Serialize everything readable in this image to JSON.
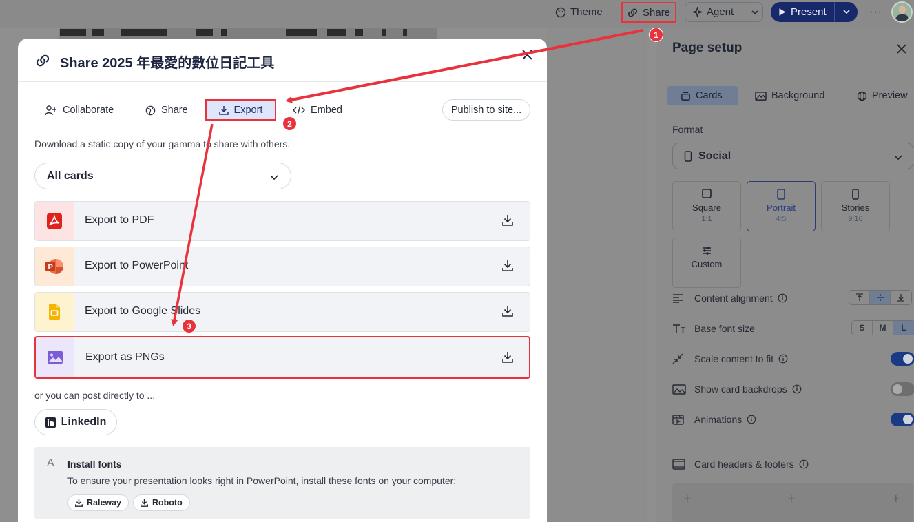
{
  "topbar": {
    "theme_label": "Theme",
    "share_label": "Share",
    "agent_label": "Agent",
    "present_label": "Present",
    "more_label": "···"
  },
  "modal": {
    "title": "Share 2025 年最愛的數位日記工具",
    "tabs": [
      {
        "label": "Collaborate",
        "icon": "user-plus-icon"
      },
      {
        "label": "Share",
        "icon": "globe-icon"
      },
      {
        "label": "Export",
        "icon": "download-icon",
        "active": true
      },
      {
        "label": "Embed",
        "icon": "code-icon"
      }
    ],
    "publish_label": "Publish to site...",
    "description": "Download a static copy of your gamma to share with others.",
    "scope_select": "All cards",
    "export_options": [
      {
        "label": "Export to PDF",
        "icon": "pdf-icon",
        "color": "#fde3e3"
      },
      {
        "label": "Export to PowerPoint",
        "icon": "powerpoint-icon",
        "color": "#fde9d6"
      },
      {
        "label": "Export to Google Slides",
        "icon": "google-slides-icon",
        "color": "#fdf3cf"
      },
      {
        "label": "Export as PNGs",
        "icon": "image-icon",
        "color": "#ece6fb"
      }
    ],
    "post_prompt": "or you can post directly to ...",
    "linkedin_label": "LinkedIn",
    "fonts": {
      "icon": "A",
      "title": "Install fonts",
      "description": "To ensure your presentation looks right in PowerPoint, install these fonts on your computer:",
      "items": [
        "Raleway",
        "Roboto"
      ]
    }
  },
  "page_setup": {
    "title": "Page setup",
    "tabs": [
      "Cards",
      "Background",
      "Preview"
    ],
    "format_label": "Format",
    "format_value": "Social",
    "formats": [
      {
        "name": "Square",
        "ratio": "1:1"
      },
      {
        "name": "Portrait",
        "ratio": "4:5",
        "selected": true
      },
      {
        "name": "Stories",
        "ratio": "9:16"
      },
      {
        "name": "Custom",
        "ratio": ""
      }
    ],
    "options": [
      {
        "label": "Content alignment"
      },
      {
        "label": "Base font size",
        "sizes": [
          "S",
          "M",
          "L"
        ],
        "selected": "L"
      },
      {
        "label": "Scale content to fit",
        "on": true
      },
      {
        "label": "Show card backdrops",
        "on": false
      },
      {
        "label": "Animations",
        "on": true
      }
    ],
    "headers_footers_label": "Card headers & footers",
    "plus_label": "+"
  },
  "annotations": {
    "step_badges": [
      "1",
      "2",
      "3"
    ],
    "highlight_color": "#e8323c"
  },
  "colors": {
    "accent_navy": "#17296b",
    "export_tab_bg": "#dfe6fb"
  }
}
